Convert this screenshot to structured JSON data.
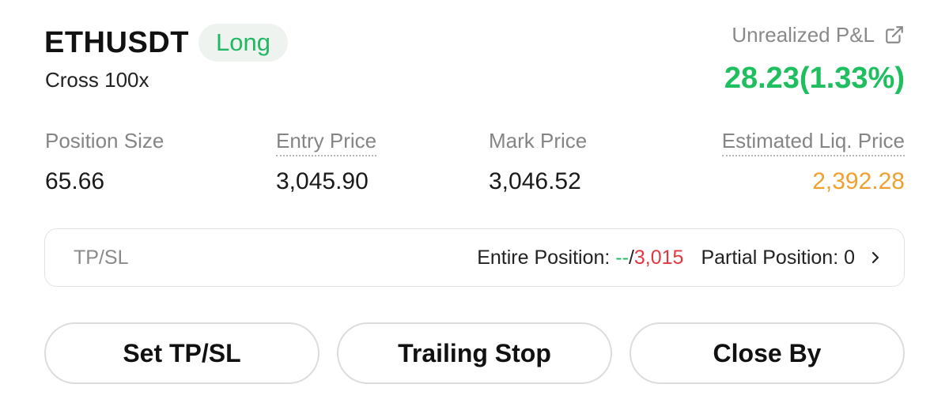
{
  "position": {
    "symbol": "ETHUSDT",
    "side": "Long",
    "margin_mode": "Cross 100x"
  },
  "pnl": {
    "label": "Unrealized P&L",
    "value": "28.23(1.33%)",
    "icon": "external-link-icon"
  },
  "stats": [
    {
      "label": "Position Size",
      "value": "65.66"
    },
    {
      "label": "Entry Price",
      "value": "3,045.90"
    },
    {
      "label": "Mark Price",
      "value": "3,046.52"
    },
    {
      "label": "Estimated Liq. Price",
      "value": "2,392.28"
    }
  ],
  "tpsl": {
    "label": "TP/SL",
    "entire_label": "Entire Position: ",
    "tp_value": "--",
    "separator": "/",
    "sl_value": "3,015",
    "partial_label": "Partial Position: 0",
    "icon": "chevron-right-icon"
  },
  "buttons": {
    "set_tpsl": "Set TP/SL",
    "trailing_stop": "Trailing Stop",
    "close_by": "Close By"
  },
  "colors": {
    "long_green": "#22b863",
    "pnl_green": "#1fbf5f",
    "liq_orange": "#f0a030",
    "sl_red": "#e0383e"
  }
}
